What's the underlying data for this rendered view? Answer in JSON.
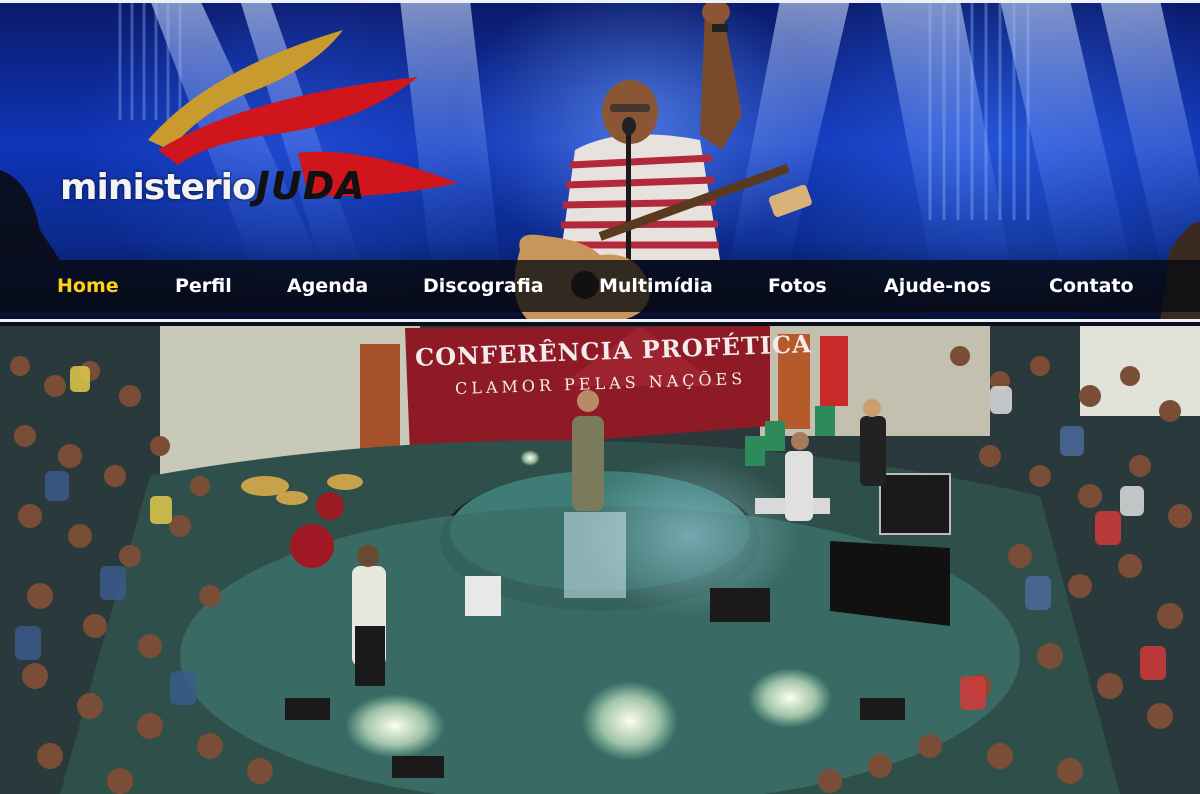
{
  "header": {
    "logo_alt": "ministerio JUDA logo",
    "logo_light_text": "ministerio",
    "logo_bold_text": "JUDA"
  },
  "nav": {
    "items": [
      {
        "label": "Home",
        "active": true
      },
      {
        "label": "Perfil",
        "active": false
      },
      {
        "label": "Agenda",
        "active": false
      },
      {
        "label": "Discografia",
        "active": false
      },
      {
        "label": "Multimídia",
        "active": false
      },
      {
        "label": "Fotos",
        "active": false
      },
      {
        "label": "Ajude-nos",
        "active": false
      },
      {
        "label": "Contato",
        "active": false
      }
    ],
    "active_color": "#ffd21a",
    "text_color": "#ffffff"
  },
  "photo": {
    "banner_title": "CONFERÊNCIA PROFÉTICA",
    "banner_subtitle": "CLAMOR PELAS NAÇÕES"
  },
  "colors": {
    "stage_blue": "#1035b8",
    "logo_gold": "#c99a2e",
    "logo_red": "#d0161c",
    "banner_red": "#8e1a26"
  }
}
